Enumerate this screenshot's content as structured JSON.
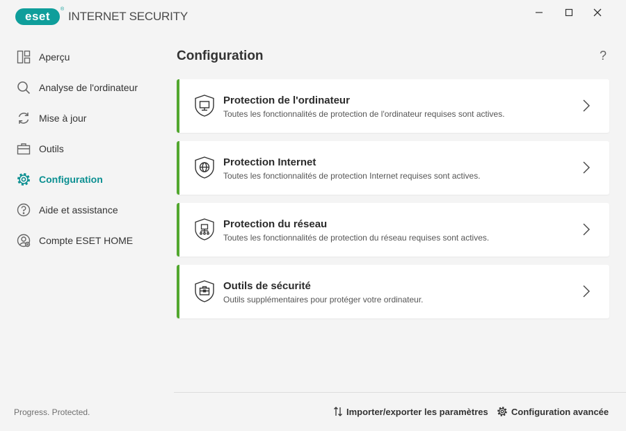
{
  "app": {
    "logo_text": "eset",
    "logo_reg": "®",
    "product_name": "INTERNET SECURITY",
    "accent": "#0f9e9b",
    "status_green": "#52a72f"
  },
  "window_controls": [
    {
      "name": "minimize-icon"
    },
    {
      "name": "maximize-icon"
    },
    {
      "name": "close-icon"
    }
  ],
  "sidebar": {
    "items": [
      {
        "label": "Aperçu",
        "icon": "dashboard-icon"
      },
      {
        "label": "Analyse de l'ordinateur",
        "icon": "magnifier-icon"
      },
      {
        "label": "Mise à jour",
        "icon": "refresh-icon"
      },
      {
        "label": "Outils",
        "icon": "briefcase-icon"
      },
      {
        "label": "Configuration",
        "icon": "gear-icon",
        "active": true
      },
      {
        "label": "Aide et assistance",
        "icon": "question-circle-icon"
      },
      {
        "label": "Compte ESET HOME",
        "icon": "account-icon"
      }
    ],
    "tagline": "Progress. Protected."
  },
  "main": {
    "title": "Configuration",
    "help_label": "?",
    "cards": [
      {
        "title": "Protection de l'ordinateur",
        "description": "Toutes les fonctionnalités de protection de l'ordinateur requises sont actives.",
        "icon": "shield-computer-icon"
      },
      {
        "title": "Protection Internet",
        "description": "Toutes les fonctionnalités de protection Internet requises sont actives.",
        "icon": "shield-globe-icon"
      },
      {
        "title": "Protection du réseau",
        "description": "Toutes les fonctionnalités de protection du réseau requises sont actives.",
        "icon": "shield-network-icon"
      },
      {
        "title": "Outils de sécurité",
        "description": "Outils supplémentaires pour protéger votre ordinateur.",
        "icon": "shield-toolbox-icon"
      }
    ]
  },
  "footer": {
    "import_export_label": "Importer/exporter les paramètres",
    "advanced_setup_label": "Configuration avancée"
  }
}
